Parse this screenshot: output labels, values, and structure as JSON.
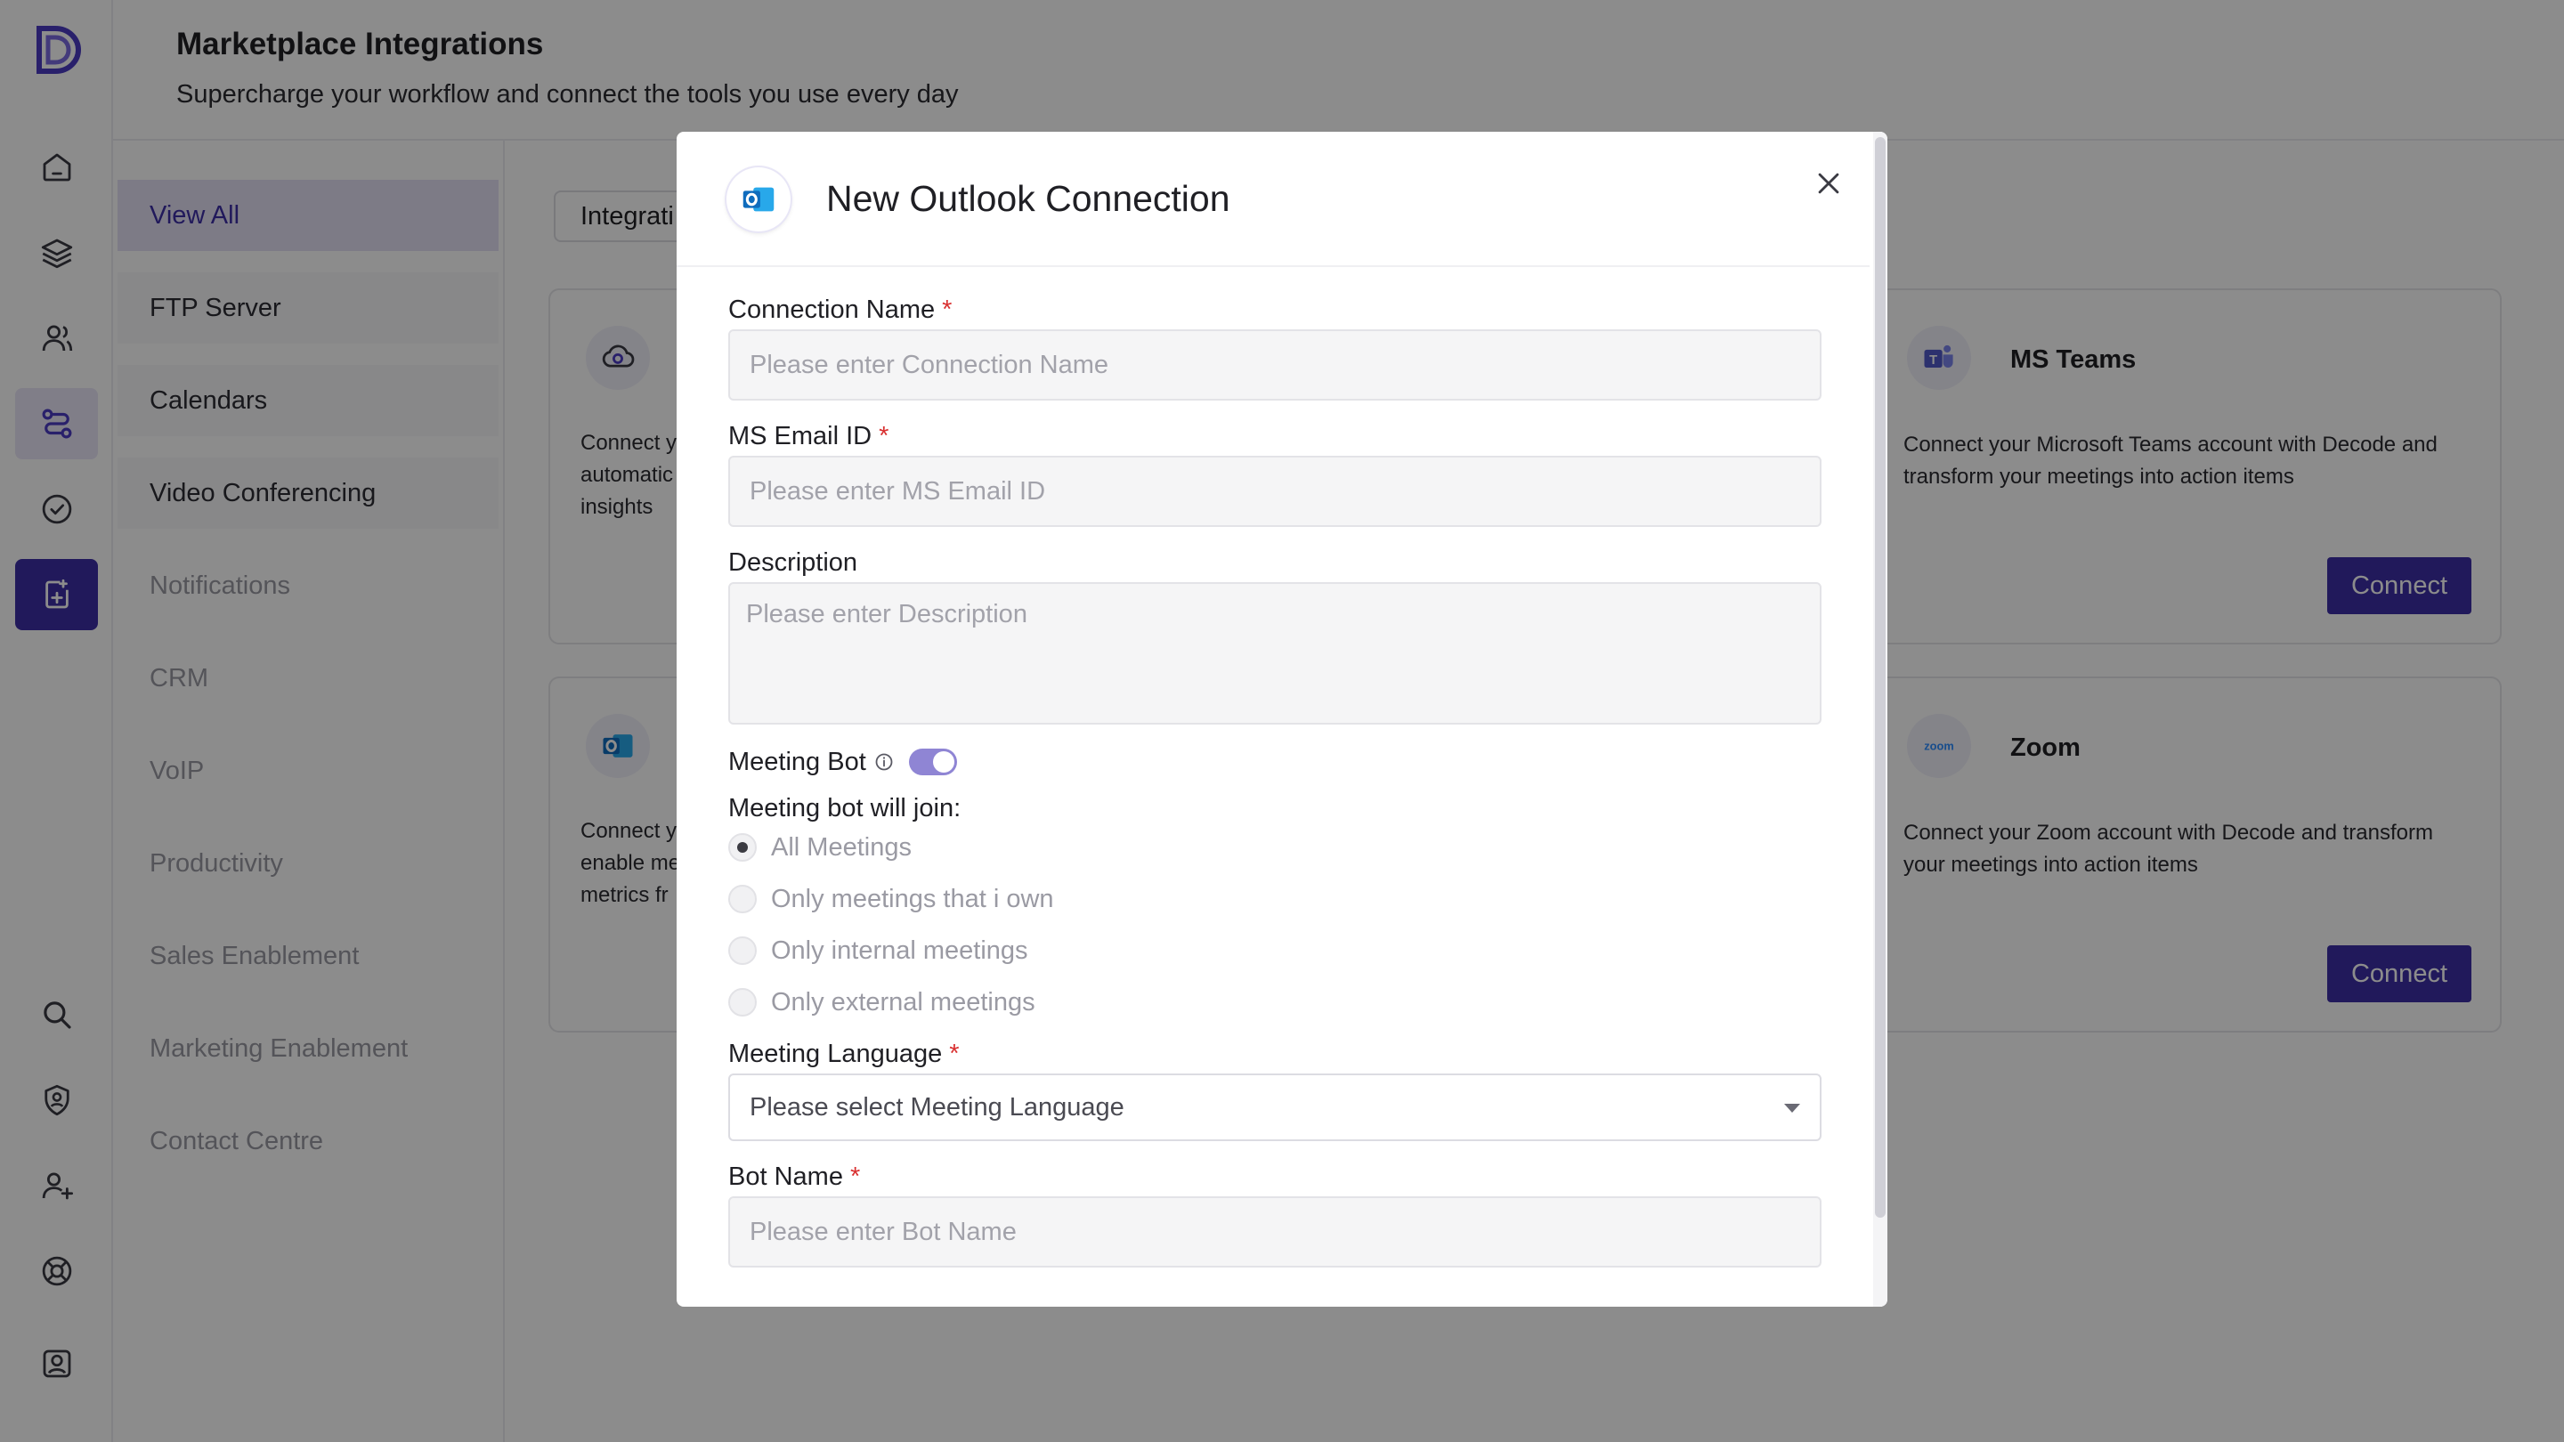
{
  "header": {
    "title": "Marketplace Integrations",
    "subtitle": "Supercharge your workflow and connect the tools you use every day"
  },
  "rail": {
    "items": [
      {
        "icon": "home-icon"
      },
      {
        "icon": "layers-icon"
      },
      {
        "icon": "users-icon"
      },
      {
        "icon": "route-icon"
      },
      {
        "icon": "check-circle-icon"
      },
      {
        "icon": "add-document-icon"
      },
      {
        "icon": "search-icon"
      },
      {
        "icon": "settings-user-icon"
      },
      {
        "icon": "add-user-icon"
      },
      {
        "icon": "help-lifebuoy-icon"
      },
      {
        "icon": "profile-icon"
      }
    ]
  },
  "categories": [
    "View All",
    "FTP Server",
    "Calendars",
    "Video Conferencing",
    "Notifications",
    "CRM",
    "VoIP",
    "Productivity",
    "Sales Enablement",
    "Marketing Enablement",
    "Contact Centre"
  ],
  "main": {
    "tab_label": "Integrati",
    "cards_left": [
      {
        "icon": "cloud-sync-icon",
        "desc_lines": [
          "Connect y",
          "automatic",
          "insights"
        ]
      },
      {
        "icon": "outlook-icon",
        "desc_lines": [
          "Connect y",
          "enable me",
          "metrics fr"
        ]
      }
    ],
    "cards_right": [
      {
        "title": "MS Teams",
        "icon": "ms-teams-icon",
        "desc": "Connect your Microsoft Teams account with Decode and transform your meetings into action items",
        "button": "Connect"
      },
      {
        "title": "Zoom",
        "icon": "zoom-icon",
        "desc": "Connect your Zoom account with Decode and transform your meetings into action items",
        "button": "Connect"
      }
    ]
  },
  "modal": {
    "title": "New Outlook Connection",
    "connection_name": {
      "label": "Connection Name",
      "required": "*",
      "placeholder": "Please enter Connection Name"
    },
    "ms_email": {
      "label": "MS Email ID",
      "required": "*",
      "placeholder": "Please enter MS Email ID"
    },
    "description": {
      "label": "Description",
      "placeholder": "Please enter Description"
    },
    "meeting_bot": {
      "label": "Meeting Bot",
      "enabled": true
    },
    "join_label": "Meeting bot will join:",
    "join_options": [
      {
        "label": "All Meetings",
        "selected": true
      },
      {
        "label": "Only meetings that i own",
        "selected": false
      },
      {
        "label": "Only internal meetings",
        "selected": false
      },
      {
        "label": "Only external meetings",
        "selected": false
      }
    ],
    "meeting_language": {
      "label": "Meeting Language",
      "required": "*",
      "placeholder": "Please select Meeting Language"
    },
    "bot_name": {
      "label": "Bot Name",
      "required": "*",
      "placeholder": "Please enter Bot Name"
    }
  },
  "colors": {
    "brand": "#3d2ea6",
    "active_category_bg": "#e4e0f5",
    "toggle_on": "#8f85d4",
    "required": "#d93131"
  }
}
